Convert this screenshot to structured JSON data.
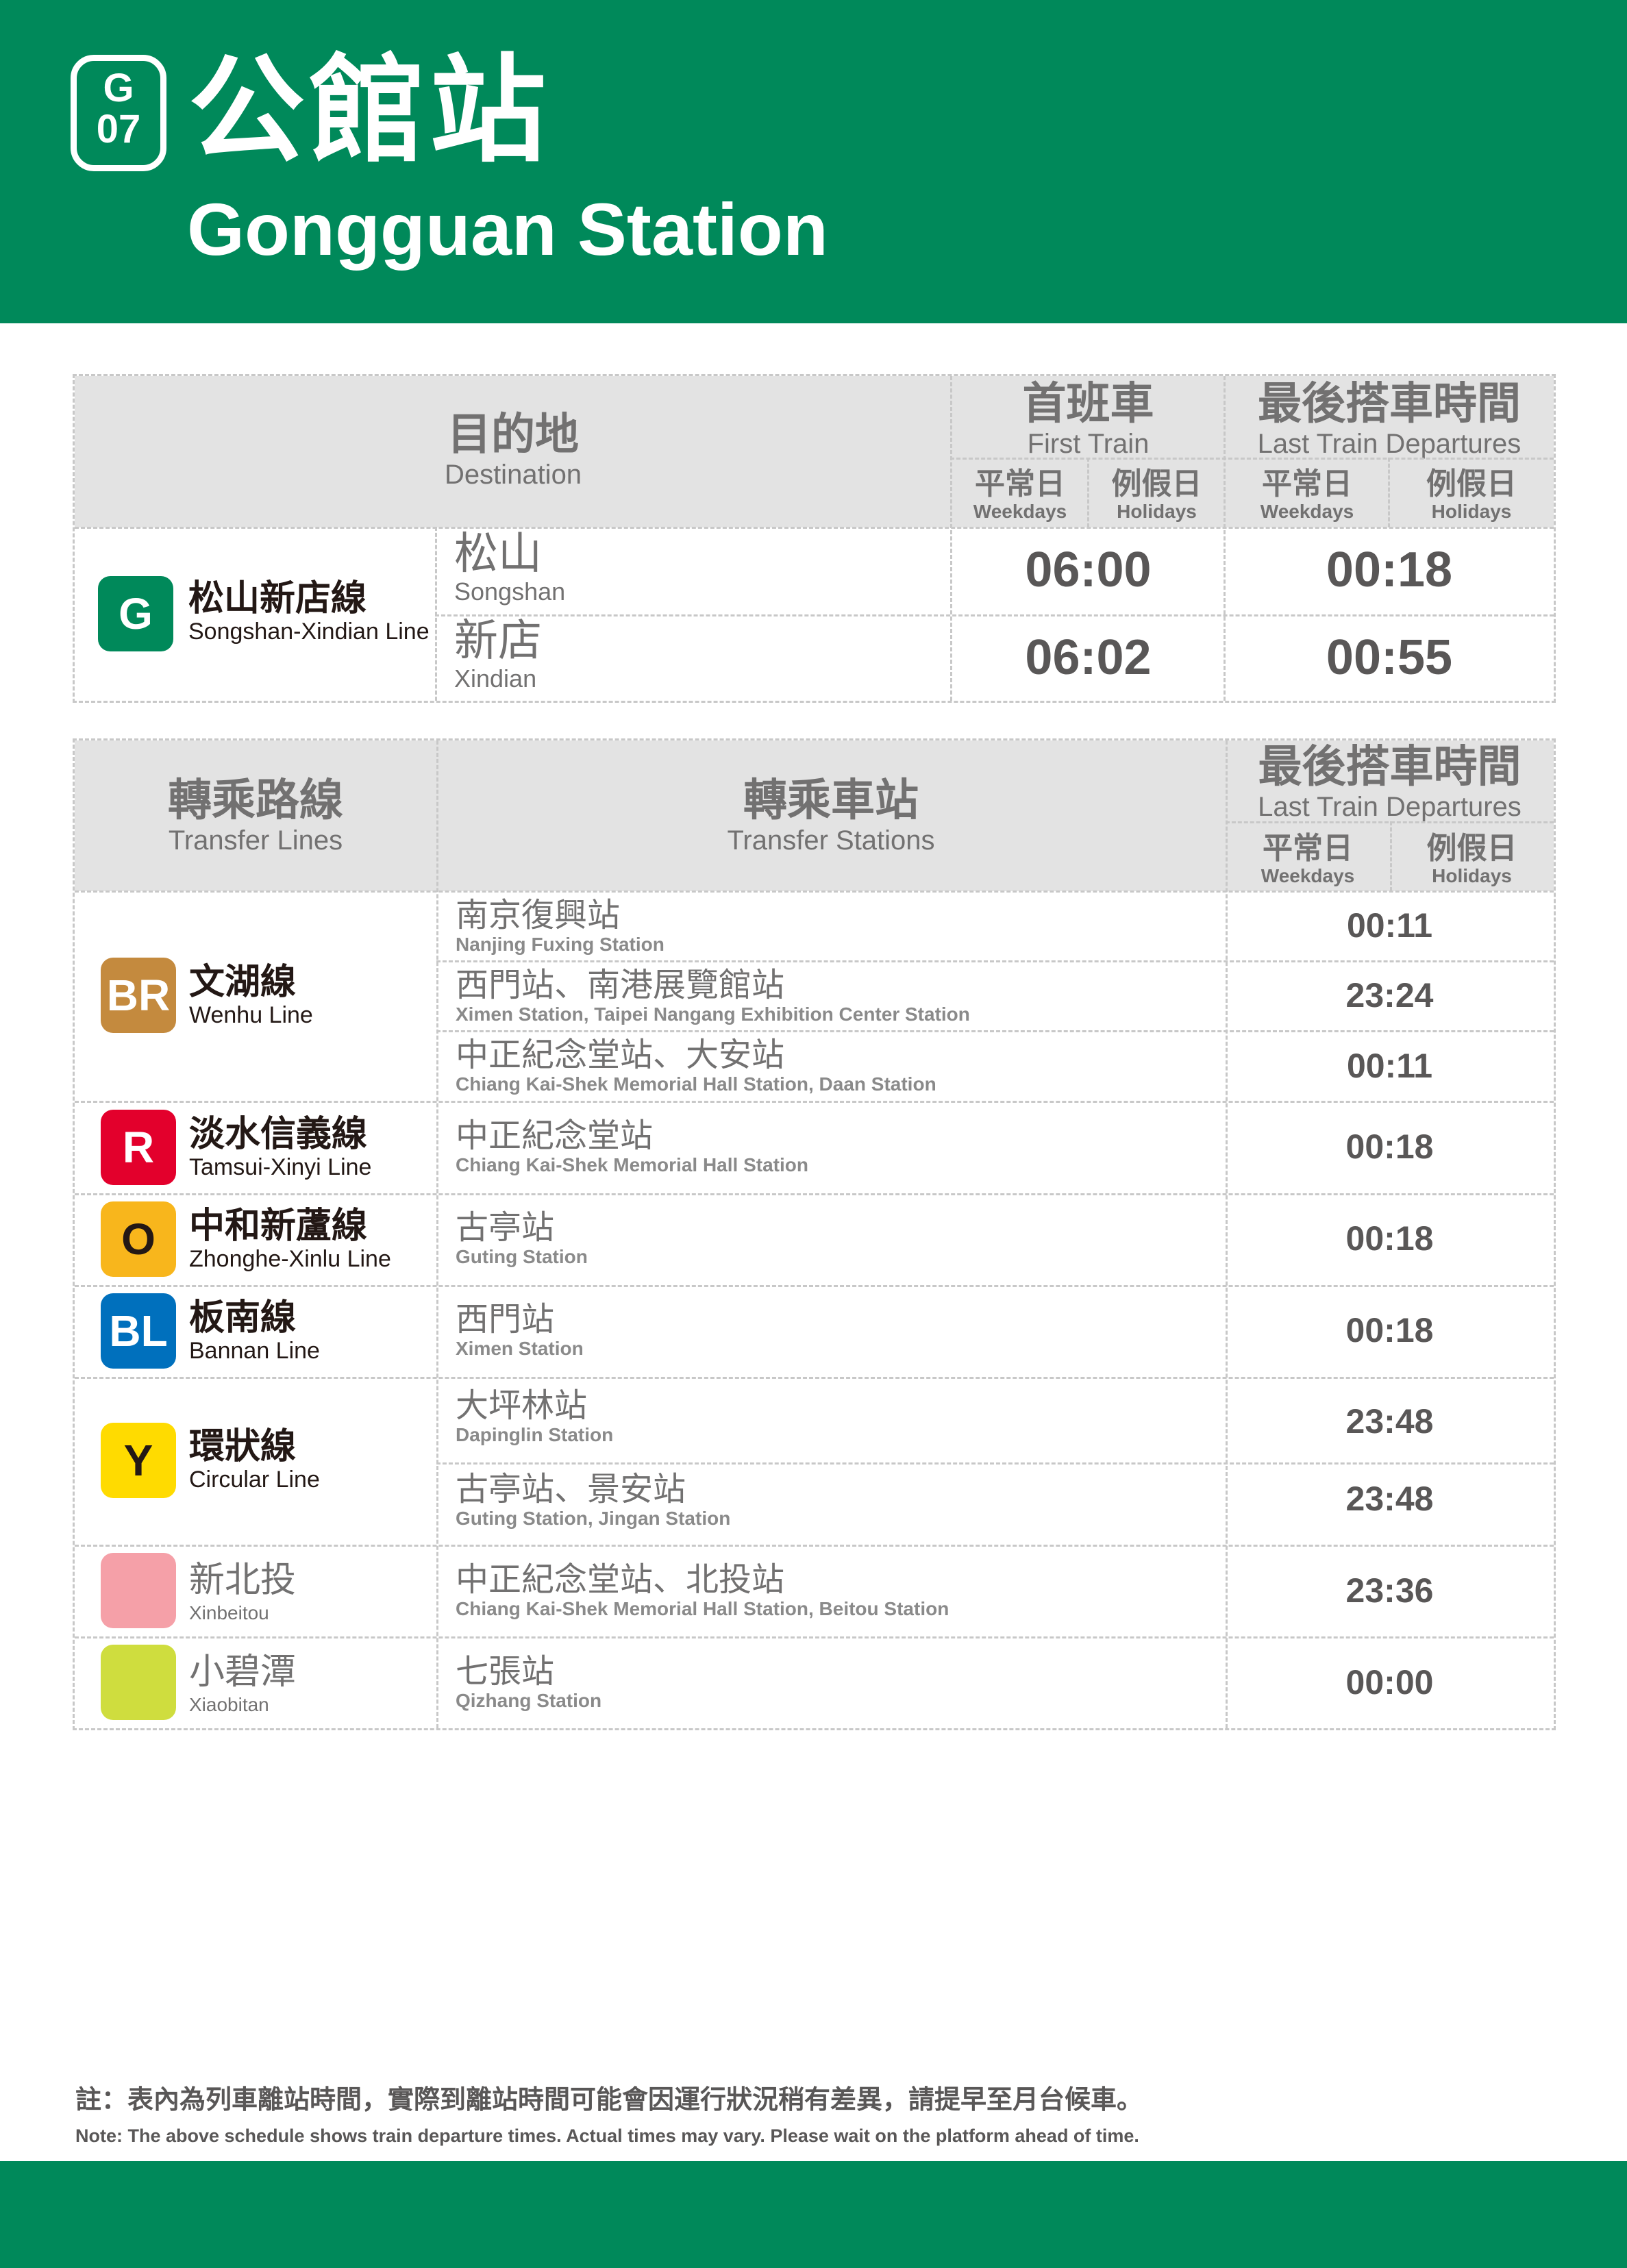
{
  "station": {
    "line_letter": "G",
    "line_number": "07",
    "name_zh": "公館站",
    "name_en": "Gongguan Station"
  },
  "colors": {
    "green": "#00895a",
    "header_grey": "#e3e3e3",
    "BR": "#c48a3e",
    "R": "#e3002c",
    "O": "#f8b61c",
    "BL": "#0070bd",
    "Y": "#ffdb00",
    "Xinbeitou": "#f5a0a8",
    "Xiaobitan": "#cfdd3e"
  },
  "table1": {
    "dest_zh": "目的地",
    "dest_en": "Destination",
    "first_zh": "首班車",
    "first_en": "First Train",
    "last_zh": "最後搭車時間",
    "last_en": "Last Train Departures",
    "weekdays_zh": "平常日",
    "weekdays_en": "Weekdays",
    "holidays_zh": "例假日",
    "holidays_en": "Holidays",
    "line_code": "G",
    "line_zh": "松山新店線",
    "line_en": "Songshan-Xindian Line",
    "rows": [
      {
        "dest_zh": "松山",
        "dest_en": "Songshan",
        "first": "06:00",
        "last": "00:18"
      },
      {
        "dest_zh": "新店",
        "dest_en": "Xindian",
        "first": "06:02",
        "last": "00:55"
      }
    ]
  },
  "table2": {
    "lines_zh": "轉乘路線",
    "lines_en": "Transfer Lines",
    "stations_zh": "轉乘車站",
    "stations_en": "Transfer Stations",
    "last_zh": "最後搭車時間",
    "last_en": "Last Train Departures",
    "weekdays_zh": "平常日",
    "weekdays_en": "Weekdays",
    "holidays_zh": "例假日",
    "holidays_en": "Holidays",
    "lines": [
      {
        "code": "BR",
        "zh": "文湖線",
        "en": "Wenhu Line"
      },
      {
        "code": "R",
        "zh": "淡水信義線",
        "en": "Tamsui-Xinyi Line"
      },
      {
        "code": "O",
        "zh": "中和新蘆線",
        "en": "Zhonghe-Xinlu Line"
      },
      {
        "code": "BL",
        "zh": "板南線",
        "en": "Bannan Line"
      },
      {
        "code": "Y",
        "zh": "環狀線",
        "en": "Circular Line"
      },
      {
        "code": "",
        "zh": "新北投",
        "en": "Xinbeitou"
      },
      {
        "code": "",
        "zh": "小碧潭",
        "en": "Xiaobitan"
      }
    ],
    "rows": [
      {
        "zh": "南京復興站",
        "en": "Nanjing Fuxing Station",
        "time": "00:11"
      },
      {
        "zh": "西門站、南港展覽館站",
        "en": "Ximen Station, Taipei Nangang Exhibition Center Station",
        "time": "23:24"
      },
      {
        "zh": "中正紀念堂站、大安站",
        "en": "Chiang Kai-Shek Memorial Hall Station, Daan Station",
        "time": "00:11"
      },
      {
        "zh": "中正紀念堂站",
        "en": "Chiang Kai-Shek Memorial Hall Station",
        "time": "00:18"
      },
      {
        "zh": "古亭站",
        "en": "Guting Station",
        "time": "00:18"
      },
      {
        "zh": "西門站",
        "en": "Ximen Station",
        "time": "00:18"
      },
      {
        "zh": "大坪林站",
        "en": "Dapinglin Station",
        "time": "23:48"
      },
      {
        "zh": "古亭站、景安站",
        "en": "Guting Station, Jingan Station",
        "time": "23:48"
      },
      {
        "zh": "中正紀念堂站、北投站",
        "en": "Chiang Kai-Shek Memorial Hall Station, Beitou Station",
        "time": "23:36"
      },
      {
        "zh": "七張站",
        "en": "Qizhang Station",
        "time": "00:00"
      }
    ]
  },
  "note": {
    "zh": "註：表內為列車離站時間，實際到離站時間可能會因運行狀況稍有差異，請提早至月台候車。",
    "en": "Note: The above schedule shows train departure times. Actual times may vary. Please wait on the platform ahead of time."
  }
}
